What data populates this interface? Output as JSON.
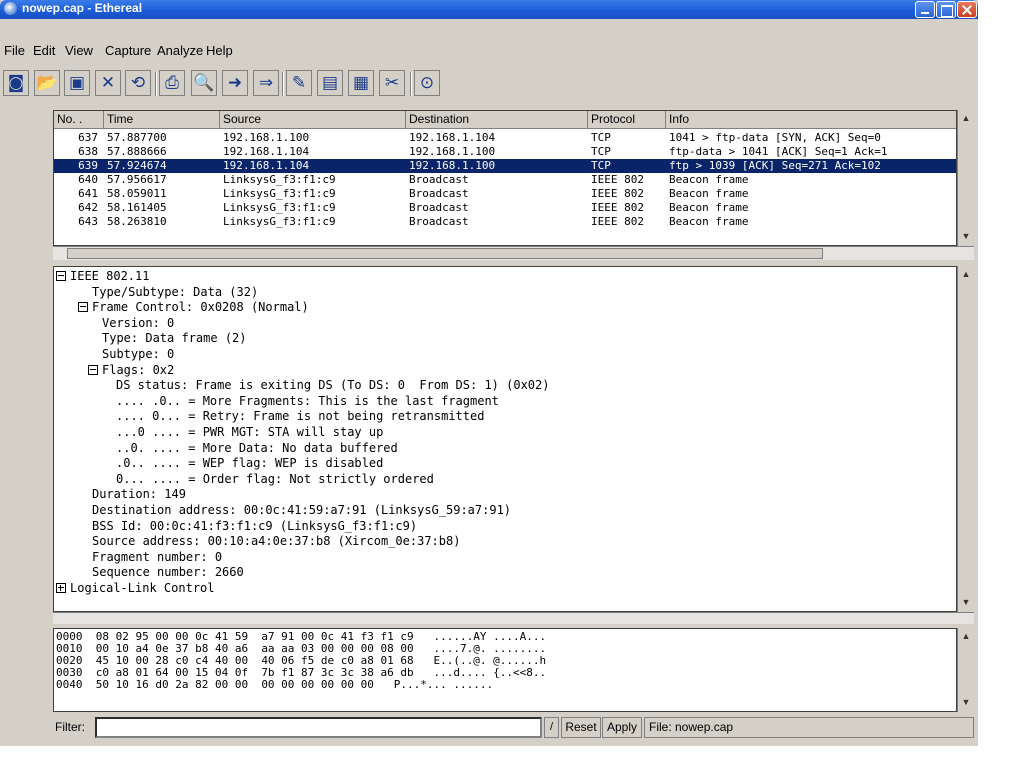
{
  "window": {
    "title": "nowep.cap - Ethereal"
  },
  "menu": [
    "File",
    "Edit",
    "View",
    "Capture",
    "Analyze",
    "Help"
  ],
  "toolbar": [
    {
      "name": "interfaces-icon",
      "glyph": "◙"
    },
    {
      "name": "open-icon",
      "glyph": "📂"
    },
    {
      "name": "save-icon",
      "glyph": "▣"
    },
    {
      "name": "close-capture-icon",
      "glyph": "✕"
    },
    {
      "name": "reload-icon",
      "glyph": "⟲"
    },
    {
      "name": "print-icon",
      "glyph": "⎙"
    },
    {
      "name": "find-icon",
      "glyph": "🔍"
    },
    {
      "name": "go-to-icon",
      "glyph": "➜"
    },
    {
      "name": "go-packet-icon",
      "glyph": "⇒"
    },
    {
      "name": "capture-filter-icon",
      "glyph": "✎"
    },
    {
      "name": "display-filter-icon",
      "glyph": "▤"
    },
    {
      "name": "coloring-icon",
      "glyph": "▦"
    },
    {
      "name": "preferences-icon",
      "glyph": "✂"
    },
    {
      "name": "help-icon",
      "glyph": "⊙"
    }
  ],
  "packet_list": {
    "columns": [
      "No. .",
      "Time",
      "Source",
      "Destination",
      "Protocol",
      "Info"
    ],
    "rows": [
      {
        "no": "637",
        "time": "57.887700",
        "source": "192.168.1.100",
        "destination": "192.168.1.104",
        "protocol": "TCP",
        "info": "1041 > ftp-data [SYN, ACK] Seq=0",
        "selected": false
      },
      {
        "no": "638",
        "time": "57.888666",
        "source": "192.168.1.104",
        "destination": "192.168.1.100",
        "protocol": "TCP",
        "info": "ftp-data > 1041 [ACK] Seq=1 Ack=1",
        "selected": false
      },
      {
        "no": "639",
        "time": "57.924674",
        "source": "192.168.1.104",
        "destination": "192.168.1.100",
        "protocol": "TCP",
        "info": "ftp > 1039 [ACK] Seq=271 Ack=102",
        "selected": true
      },
      {
        "no": "640",
        "time": "57.956617",
        "source": "LinksysG_f3:f1:c9",
        "destination": "Broadcast",
        "protocol": "IEEE 802",
        "info": "Beacon frame",
        "selected": false
      },
      {
        "no": "641",
        "time": "58.059011",
        "source": "LinksysG_f3:f1:c9",
        "destination": "Broadcast",
        "protocol": "IEEE 802",
        "info": "Beacon frame",
        "selected": false
      },
      {
        "no": "642",
        "time": "58.161405",
        "source": "LinksysG_f3:f1:c9",
        "destination": "Broadcast",
        "protocol": "IEEE 802",
        "info": "Beacon frame",
        "selected": false
      },
      {
        "no": "643",
        "time": "58.263810",
        "source": "LinksysG_f3:f1:c9",
        "destination": "Broadcast",
        "protocol": "IEEE 802",
        "info": "Beacon frame",
        "selected": false
      }
    ]
  },
  "details": [
    {
      "level": 0,
      "toggle": "minus",
      "text": "IEEE 802.11"
    },
    {
      "level": 1,
      "toggle": "",
      "text": "Type/Subtype: Data (32)"
    },
    {
      "level": 1,
      "toggle": "minus",
      "text": "Frame Control: 0x0208 (Normal)"
    },
    {
      "level": 2,
      "toggle": "",
      "text": "Version: 0"
    },
    {
      "level": 2,
      "toggle": "",
      "text": "Type: Data frame (2)"
    },
    {
      "level": 2,
      "toggle": "",
      "text": "Subtype: 0"
    },
    {
      "level": 2,
      "toggle": "minus",
      "text": "Flags: 0x2"
    },
    {
      "level": 3,
      "toggle": "",
      "text": "DS status: Frame is exiting DS (To DS: 0  From DS: 1) (0x02)"
    },
    {
      "level": 3,
      "toggle": "",
      "text": ".... .0.. = More Fragments: This is the last fragment"
    },
    {
      "level": 3,
      "toggle": "",
      "text": ".... 0... = Retry: Frame is not being retransmitted"
    },
    {
      "level": 3,
      "toggle": "",
      "text": "...0 .... = PWR MGT: STA will stay up"
    },
    {
      "level": 3,
      "toggle": "",
      "text": "..0. .... = More Data: No data buffered"
    },
    {
      "level": 3,
      "toggle": "",
      "text": ".0.. .... = WEP flag: WEP is disabled"
    },
    {
      "level": 3,
      "toggle": "",
      "text": "0... .... = Order flag: Not strictly ordered"
    },
    {
      "level": 1,
      "toggle": "",
      "text": "Duration: 149"
    },
    {
      "level": 1,
      "toggle": "",
      "text": "Destination address: 00:0c:41:59:a7:91 (LinksysG_59:a7:91)"
    },
    {
      "level": 1,
      "toggle": "",
      "text": "BSS Id: 00:0c:41:f3:f1:c9 (LinksysG_f3:f1:c9)"
    },
    {
      "level": 1,
      "toggle": "",
      "text": "Source address: 00:10:a4:0e:37:b8 (Xircom_0e:37:b8)"
    },
    {
      "level": 1,
      "toggle": "",
      "text": "Fragment number: 0"
    },
    {
      "level": 1,
      "toggle": "",
      "text": "Sequence number: 2660"
    },
    {
      "level": 0,
      "toggle": "plus",
      "text": "Logical-Link Control"
    }
  ],
  "hex": [
    {
      "offset": "0000",
      "bytes": "08 02 95 00 00 0c 41 59  a7 91 00 0c 41 f3 f1 c9",
      "ascii": "......AY ....A..."
    },
    {
      "offset": "0010",
      "bytes": "00 10 a4 0e 37 b8 40 a6  aa aa 03 00 00 00 08 00",
      "ascii": "....7.@. ........"
    },
    {
      "offset": "0020",
      "bytes": "45 10 00 28 c0 c4 40 00  40 06 f5 de c0 a8 01 68",
      "ascii": "E..(..@. @......h"
    },
    {
      "offset": "0030",
      "bytes": "c0 a8 01 64 00 15 04 0f  7b f1 87 3c 3c 38 a6 db",
      "ascii": "...d.... {..<<8.."
    },
    {
      "offset": "0040",
      "bytes": "50 10 16 d0 2a 82 00 00  00 00 00 00 00 00",
      "ascii": "P...*... ......"
    }
  ],
  "status": {
    "filter_label": "Filter:",
    "filter_value": "",
    "filter_button": "/",
    "reset": "Reset",
    "apply": "Apply",
    "file": "File: nowep.cap"
  }
}
